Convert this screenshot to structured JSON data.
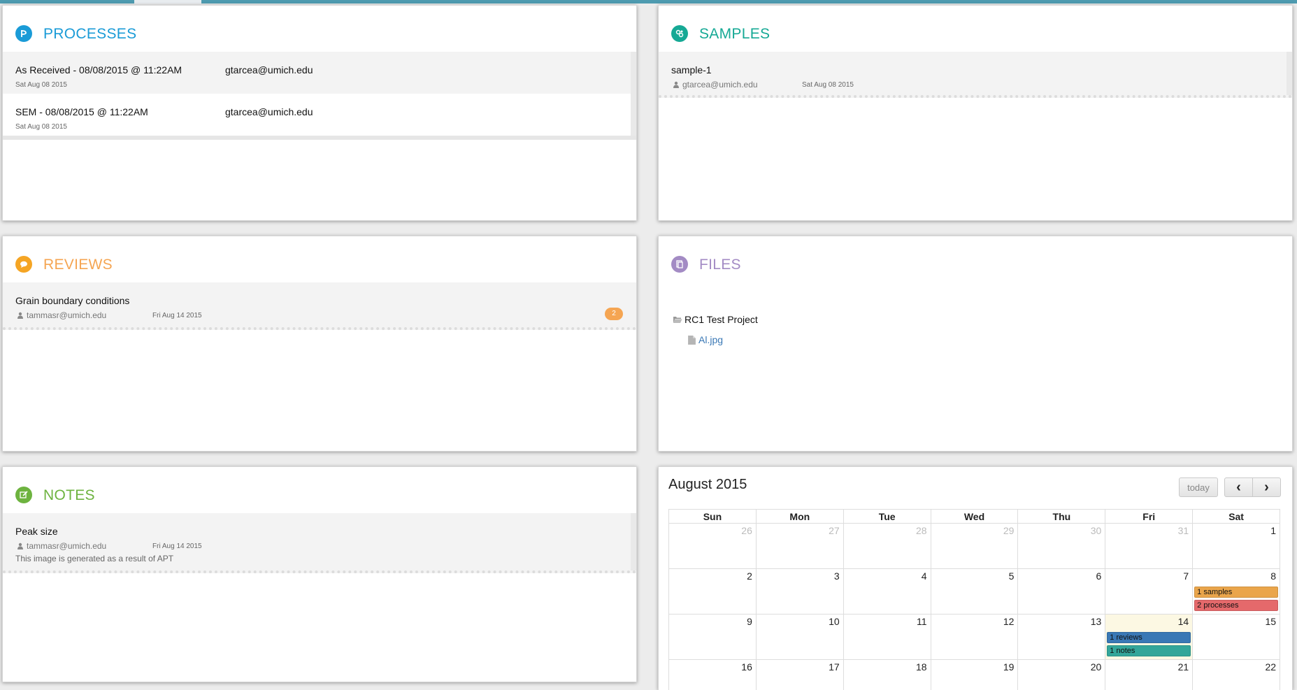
{
  "colors": {
    "processes": "#1a9bd7",
    "samples": "#16a995",
    "reviews": "#f5a552",
    "files": "#a38bc4",
    "notes": "#6db33f",
    "ev_samples": "#eaa54b",
    "ev_processes": "#e5696b",
    "ev_reviews": "#3a78b5",
    "ev_notes": "#33a69a"
  },
  "processes": {
    "title": "PROCESSES",
    "icon": "process-icon",
    "items": [
      {
        "name": "As Received - 08/08/2015 @ 11:22AM",
        "owner": "gtarcea@umich.edu",
        "date": "Sat Aug 08 2015"
      },
      {
        "name": "SEM - 08/08/2015 @ 11:22AM",
        "owner": "gtarcea@umich.edu",
        "date": "Sat Aug 08 2015"
      }
    ]
  },
  "samples": {
    "title": "SAMPLES",
    "icon": "samples-icon",
    "items": [
      {
        "name": "sample-1",
        "owner": "gtarcea@umich.edu",
        "date": "Sat Aug 08 2015"
      }
    ]
  },
  "reviews": {
    "title": "REVIEWS",
    "icon": "chat-bubble-icon",
    "items": [
      {
        "name": "Grain boundary conditions",
        "owner": "tammasr@umich.edu",
        "date": "Fri Aug 14 2015",
        "comments": "2"
      }
    ]
  },
  "files": {
    "title": "FILES",
    "icon": "files-icon",
    "folder": "RC1 Test Project",
    "file": "Al.jpg"
  },
  "notes": {
    "title": "NOTES",
    "icon": "edit-note-icon",
    "items": [
      {
        "name": "Peak size",
        "owner": "tammasr@umich.edu",
        "date": "Fri Aug 14 2015",
        "body": "This image is generated as a result of APT"
      }
    ]
  },
  "calendar": {
    "title": "August 2015",
    "today_label": "today",
    "prev_label": "‹",
    "next_label": "›",
    "weekdays": [
      "Sun",
      "Mon",
      "Tue",
      "Wed",
      "Thu",
      "Fri",
      "Sat"
    ],
    "weeks": [
      [
        "26",
        "27",
        "28",
        "29",
        "30",
        "31",
        "1"
      ],
      [
        "2",
        "3",
        "4",
        "5",
        "6",
        "7",
        "8"
      ],
      [
        "9",
        "10",
        "11",
        "12",
        "13",
        "14",
        "15"
      ],
      [
        "16",
        "17",
        "18",
        "19",
        "20",
        "21",
        "22"
      ]
    ],
    "events": {
      "samples": "1 samples",
      "processes": "2 processes",
      "reviews": "1 reviews",
      "notes": "1 notes"
    }
  }
}
